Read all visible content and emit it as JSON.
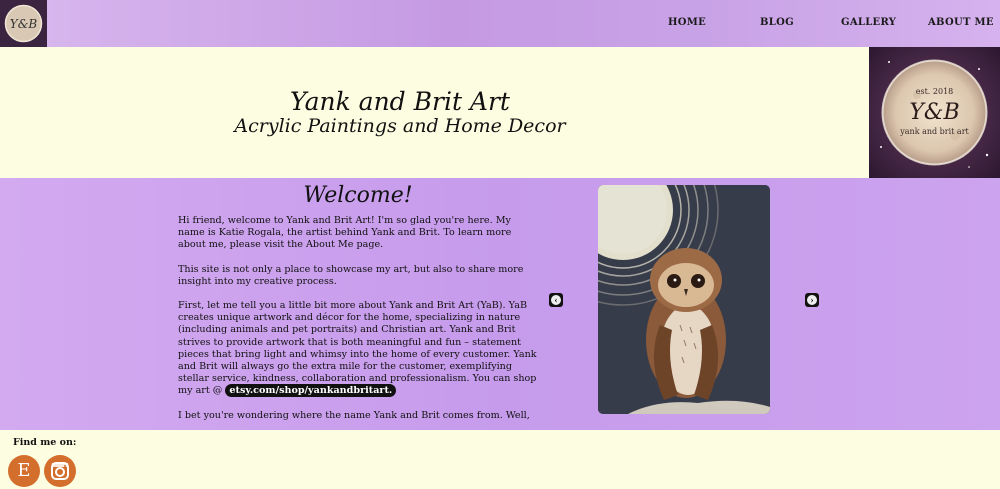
{
  "nav": {
    "logo_text": "Y&B",
    "items": [
      {
        "label": "HOME"
      },
      {
        "label": "BLOG"
      },
      {
        "label": "GALLERY"
      },
      {
        "label": "ABOUT ME"
      }
    ]
  },
  "header": {
    "title": "Yank and Brit Art",
    "subtitle": "Acrylic Paintings and Home Decor",
    "logo": {
      "est": "est. 2018",
      "monogram": "Y&B",
      "caption": "yank and brit art"
    }
  },
  "main": {
    "heading": "Welcome!",
    "paragraphs": {
      "p1": "Hi friend, welcome to Yank and Brit Art! I'm so glad you're here. My name is Katie Rogala, the artist behind Yank and Brit. To learn more about me, please visit the About Me page.",
      "p2": "This site is not only a place to showcase my art, but also to share more insight into my creative process.",
      "p3_text": "First, let me tell you a little bit more about Yank and Brit Art (YaB). YaB creates unique artwork and décor for the home, specializing in nature (including animals and pet portraits) and Christian art. Yank and Brit strives to provide artwork that is both meaningful and fun – statement pieces that bring light and whimsy into the home of every customer. Yank and Brit will always go the extra mile for the customer, exemplifying stellar service, kindness, collaboration and professionalism. You can shop my art @ ",
      "p3_link": "etsy.com/shop/yankandbritart.",
      "p4": "I bet you're wondering where the name Yank and Brit comes from. Well,"
    },
    "carousel": {
      "image_subject": "owl-painting",
      "prev_icon": "chevron-left-icon",
      "next_icon": "chevron-right-icon"
    }
  },
  "footer": {
    "find_label": "Find me on:",
    "social": [
      {
        "name": "etsy",
        "letter": "E",
        "icon": "etsy-icon"
      },
      {
        "name": "instagram",
        "icon": "instagram-icon"
      }
    ]
  },
  "colors": {
    "nav_purple": "#c59ae3",
    "main_purple": "#c69bec",
    "cream": "#fdfde2",
    "social_orange": "#d36e2c"
  }
}
